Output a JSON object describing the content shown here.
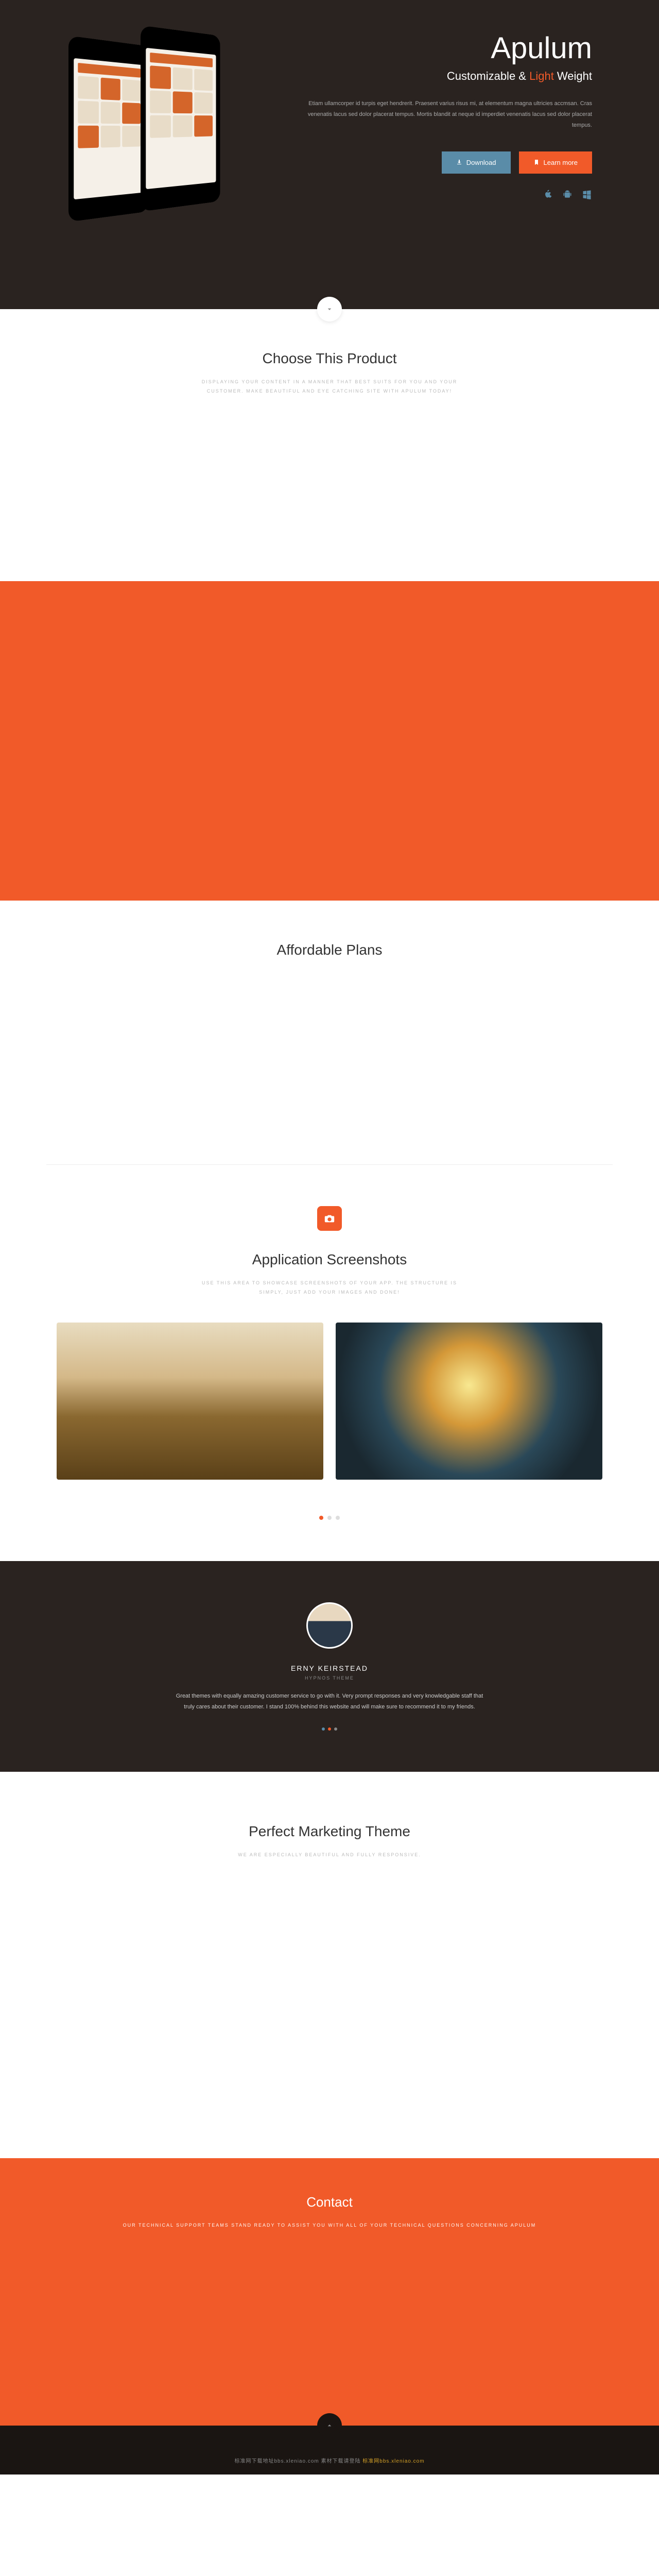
{
  "hero": {
    "brand": "Apulum",
    "tagline_pre": "Customizable & ",
    "tagline_accent": "Light",
    "tagline_post": " Weight",
    "desc": "Etiam ullamcorper id turpis eget hendrerit. Praesent varius risus mi, at elementum magna ultricies accmsan. Cras venenatis lacus sed dolor placerat tempus. Mortis blandit at neque id imperdiet venenatis lacus sed dolor placerat tempus.",
    "download_label": "Download",
    "learn_label": "Learn more"
  },
  "choose": {
    "title": "Choose This Product",
    "sub": "DISPLAYING YOUR CONTENT IN A MANNER THAT BEST SUITS FOR YOU AND YOUR CUSTOMER. MAKE BEAUTIFUL AND EYE CATCHING SITE WITH APULUM TODAY!"
  },
  "plans": {
    "title": "Affordable Plans"
  },
  "shots": {
    "title": "Application Screenshots",
    "sub": "USE THIS AREA TO SHOWCASE SCREENSHOTS OF YOUR APP. THE STRUCTURE IS SIMPLY, JUST ADD YOUR IMAGES AND DONE!"
  },
  "testimonial": {
    "name": "ERNY KEIRSTEAD",
    "role": "HYPNOS THEME",
    "quote": "Great themes with equally amazing customer service to go with it. Very prompt responses and very knowledgable staff that truly cares about their customer. I stand 100% behind this website and will make sure to recommend it to my friends."
  },
  "marketing": {
    "title": "Perfect Marketing Theme",
    "sub": "WE ARE ESPECIALLY BEAUTIFUL AND FULLY RESPONSIVE."
  },
  "contact": {
    "title": "Contact",
    "sub": "OUR TECHNICAL SUPPORT TEAMS STAND READY TO ASSIST YOU WITH ALL OF YOUR TECHNICAL QUESTIONS CONCERNING APULUM"
  },
  "footer": {
    "text_pre": "标准网下载地址bbs.xleniao.com 素材下载请登陆 ",
    "text_accent": "标准网bbs.xleniao.com"
  }
}
